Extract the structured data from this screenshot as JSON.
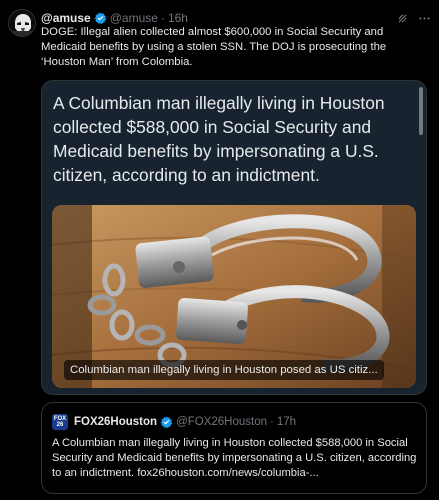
{
  "post": {
    "author_name": "@amuse",
    "handle": "@amuse",
    "separator": "·",
    "time": "16h",
    "text": "DOGE: Illegal alien collected almost $600,000 in Social Security and Medicaid benefits by using a stolen SSN. The DOJ is prosecuting the ‘Houston Man’ from Colombia.",
    "icons": [
      "avatar",
      "verified-badge-icon",
      "grok-icon",
      "more-options-icon"
    ]
  },
  "media_card": {
    "headline": "A Columbian man illegally living in Houston collected $588,000 in Social Security and Medicaid benefits by impersonating a U.S. citizen, according to an indictment.",
    "image_caption": "Columbian man illegally living in Houston posed as US citiz...",
    "image_subject": "handcuffs on wooden table"
  },
  "quote": {
    "logo_text": "FOX 26",
    "name": "FOX26Houston",
    "handle": "@FOX26Houston",
    "separator": "·",
    "time": "17h",
    "text": "A Columbian man illegally living in Houston collected $588,000 in Social Security and Medicaid benefits by impersonating a U.S. citizen, according to an indictment. fox26houston.com/news/columbia-..."
  },
  "colors": {
    "background": "#000000",
    "text": "#e7e9ea",
    "muted": "#71767b",
    "verified": "#1d9bf0",
    "card_background": "#172430",
    "border": "#2f3336"
  }
}
